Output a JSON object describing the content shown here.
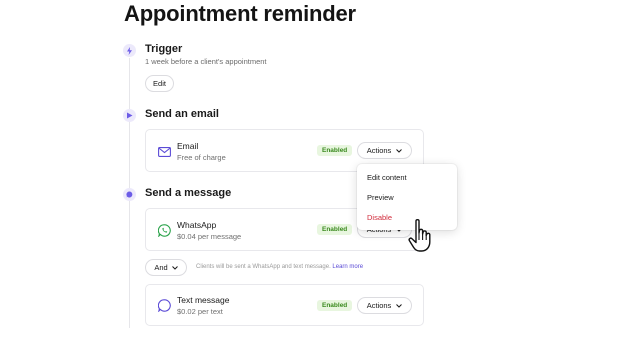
{
  "page": {
    "title": "Appointment reminder"
  },
  "trigger": {
    "title": "Trigger",
    "subtitle": "1 week before a client's appointment",
    "edit_label": "Edit"
  },
  "send_email": {
    "title": "Send an email",
    "card": {
      "name": "Email",
      "price": "Free of charge",
      "badge": "Enabled",
      "actions_label": "Actions"
    }
  },
  "send_message": {
    "title": "Send a message",
    "whatsapp": {
      "name": "WhatsApp",
      "price": "$0.04 per message",
      "badge": "Enabled",
      "actions_label": "Actions"
    },
    "and_label": "And",
    "note": "Clients will be sent a WhatsApp and text message.",
    "learn_more": "Learn more",
    "text_message": {
      "name": "Text message",
      "price": "$0.02 per text",
      "badge": "Enabled",
      "actions_label": "Actions"
    }
  },
  "dropdown": {
    "items": [
      "Edit content",
      "Preview",
      "Disable"
    ]
  },
  "colors": {
    "accent": "#6c5ce7",
    "badge_bg": "#e8f6df",
    "badge_text": "#3a8a1e",
    "danger": "#d12a3a"
  }
}
